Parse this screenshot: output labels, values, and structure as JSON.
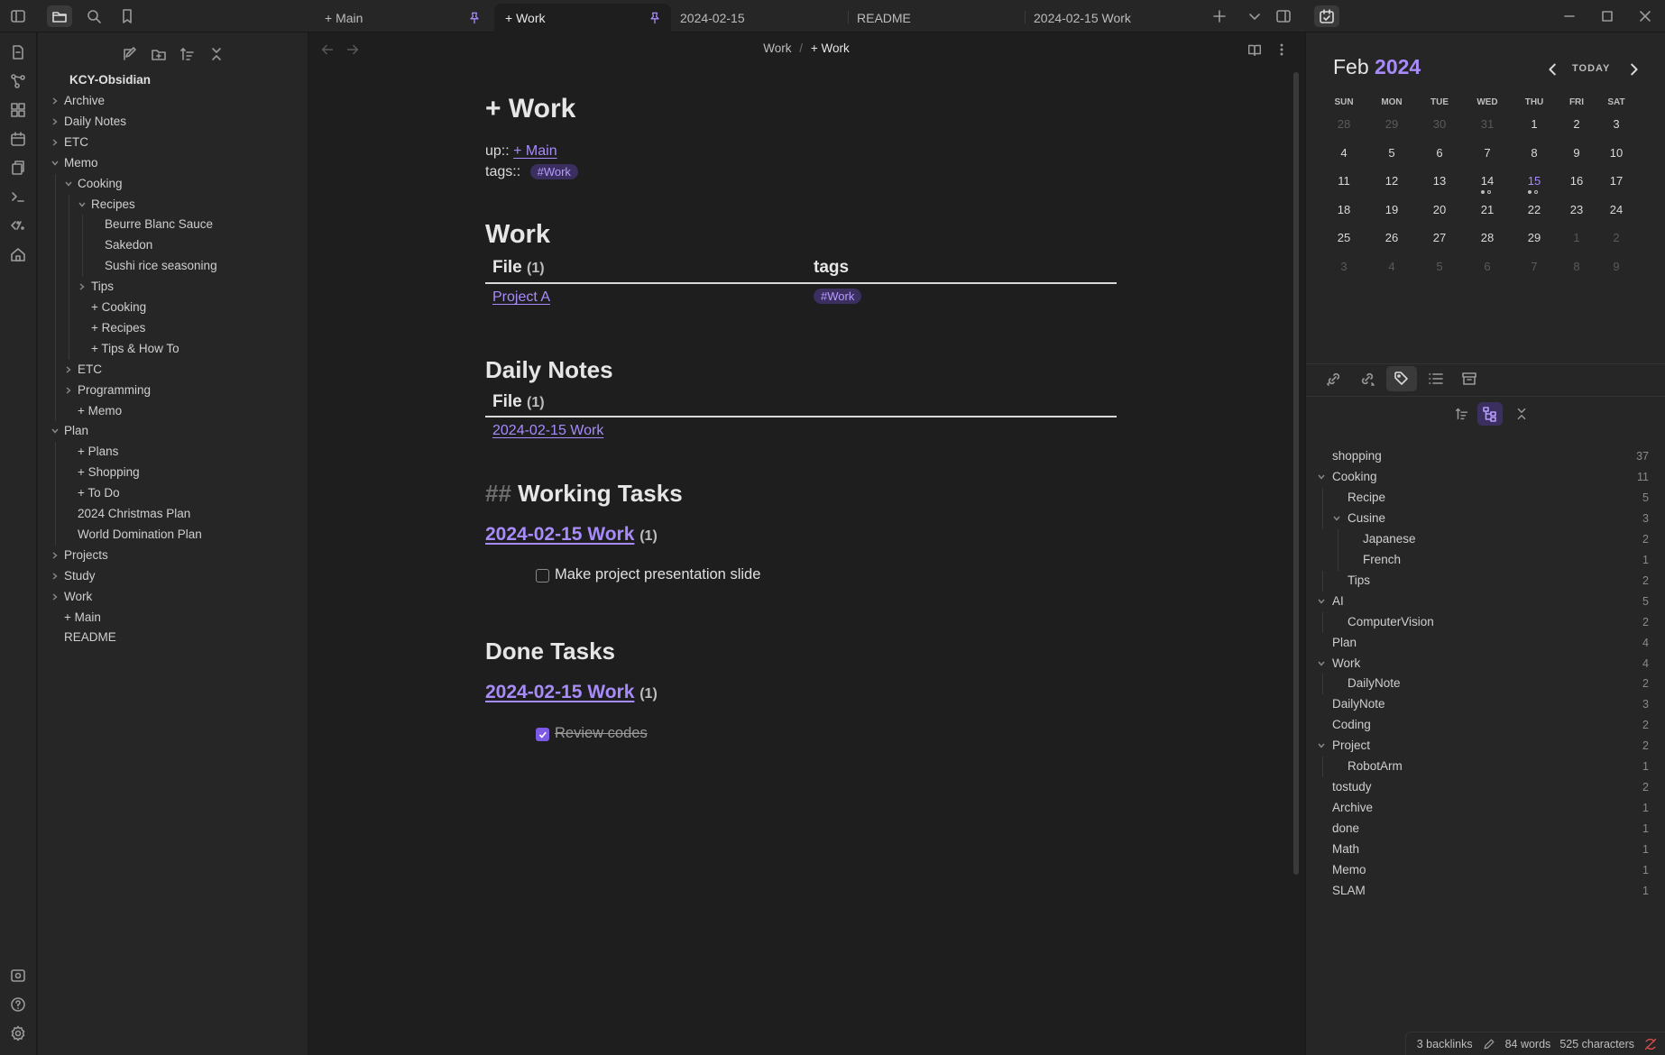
{
  "tabs": [
    {
      "label": "+ Main",
      "pinned": true
    },
    {
      "label": "+ Work",
      "pinned": true,
      "active": true
    },
    {
      "label": "2024-02-15"
    },
    {
      "label": "README"
    },
    {
      "label": "2024-02-15 Work"
    }
  ],
  "explorer": {
    "vault_name": "KCY-Obsidian",
    "items": [
      {
        "label": "Archive",
        "depth": 0,
        "folder": true,
        "open": false
      },
      {
        "label": "Daily Notes",
        "depth": 0,
        "folder": true,
        "open": false
      },
      {
        "label": "ETC",
        "depth": 0,
        "folder": true,
        "open": false
      },
      {
        "label": "Memo",
        "depth": 0,
        "folder": true,
        "open": true
      },
      {
        "label": "Cooking",
        "depth": 1,
        "folder": true,
        "open": true
      },
      {
        "label": "Recipes",
        "depth": 2,
        "folder": true,
        "open": true
      },
      {
        "label": "Beurre Blanc Sauce",
        "depth": 3,
        "folder": false
      },
      {
        "label": "Sakedon",
        "depth": 3,
        "folder": false
      },
      {
        "label": "Sushi rice seasoning",
        "depth": 3,
        "folder": false
      },
      {
        "label": "Tips",
        "depth": 2,
        "folder": true,
        "open": false
      },
      {
        "label": "+ Cooking",
        "depth": 2,
        "folder": false
      },
      {
        "label": "+ Recipes",
        "depth": 2,
        "folder": false
      },
      {
        "label": "+ Tips & How To",
        "depth": 2,
        "folder": false
      },
      {
        "label": "ETC",
        "depth": 1,
        "folder": true,
        "open": false
      },
      {
        "label": "Programming",
        "depth": 1,
        "folder": true,
        "open": false
      },
      {
        "label": "+ Memo",
        "depth": 1,
        "folder": false
      },
      {
        "label": "Plan",
        "depth": 0,
        "folder": true,
        "open": true
      },
      {
        "label": "+ Plans",
        "depth": 1,
        "folder": false
      },
      {
        "label": "+ Shopping",
        "depth": 1,
        "folder": false
      },
      {
        "label": "+ To Do",
        "depth": 1,
        "folder": false
      },
      {
        "label": "2024 Christmas Plan",
        "depth": 1,
        "folder": false
      },
      {
        "label": "World Domination Plan",
        "depth": 1,
        "folder": false
      },
      {
        "label": "Projects",
        "depth": 0,
        "folder": true,
        "open": false
      },
      {
        "label": "Study",
        "depth": 0,
        "folder": true,
        "open": false
      },
      {
        "label": "Work",
        "depth": 0,
        "folder": true,
        "open": false
      },
      {
        "label": "+ Main",
        "depth": 0,
        "folder": false
      },
      {
        "label": "README",
        "depth": 0,
        "folder": false
      }
    ]
  },
  "breadcrumb": {
    "parent": "Work",
    "separator": "/",
    "current": "+ Work"
  },
  "note": {
    "title": "+ Work",
    "up_label": "up::",
    "up_link": "+ Main",
    "tags_label": "tags::",
    "tags_value": "#Work",
    "work_heading": "Work",
    "work_table": {
      "col_file": "File",
      "col_file_count": "(1)",
      "col_tags": "tags",
      "row_file": "Project A",
      "row_tag": "#Work"
    },
    "daily_heading": "Daily Notes",
    "daily_table": {
      "col_file": "File",
      "col_file_count": "(1)",
      "row_file": "2024-02-15 Work"
    },
    "working_heading_marker": "##",
    "working_heading": "Working Tasks",
    "working_group": "2024-02-15 Work",
    "working_group_count": "(1)",
    "working_task": "Make project presentation slide",
    "done_heading": "Done Tasks",
    "done_group": "2024-02-15 Work",
    "done_group_count": "(1)",
    "done_task": "Review codes"
  },
  "calendar": {
    "month": "Feb",
    "year": "2024",
    "today_label": "TODAY",
    "weekdays": [
      "SUN",
      "MON",
      "TUE",
      "WED",
      "THU",
      "FRI",
      "SAT"
    ],
    "weeks": [
      [
        {
          "d": "28",
          "dim": true
        },
        {
          "d": "29",
          "dim": true
        },
        {
          "d": "30",
          "dim": true
        },
        {
          "d": "31",
          "dim": true
        },
        {
          "d": "1"
        },
        {
          "d": "2"
        },
        {
          "d": "3"
        }
      ],
      [
        {
          "d": "4"
        },
        {
          "d": "5"
        },
        {
          "d": "6"
        },
        {
          "d": "7"
        },
        {
          "d": "8"
        },
        {
          "d": "9"
        },
        {
          "d": "10"
        }
      ],
      [
        {
          "d": "11"
        },
        {
          "d": "12"
        },
        {
          "d": "13"
        },
        {
          "d": "14",
          "dots": [
            "filled",
            "hollow"
          ]
        },
        {
          "d": "15",
          "today": true,
          "dots": [
            "filled",
            "hollow"
          ]
        },
        {
          "d": "16"
        },
        {
          "d": "17"
        }
      ],
      [
        {
          "d": "18"
        },
        {
          "d": "19"
        },
        {
          "d": "20"
        },
        {
          "d": "21"
        },
        {
          "d": "22"
        },
        {
          "d": "23"
        },
        {
          "d": "24"
        }
      ],
      [
        {
          "d": "25"
        },
        {
          "d": "26"
        },
        {
          "d": "27"
        },
        {
          "d": "28"
        },
        {
          "d": "29"
        },
        {
          "d": "1",
          "dim": true
        },
        {
          "d": "2",
          "dim": true
        }
      ],
      [
        {
          "d": "3",
          "dim": true
        },
        {
          "d": "4",
          "dim": true
        },
        {
          "d": "5",
          "dim": true
        },
        {
          "d": "6",
          "dim": true
        },
        {
          "d": "7",
          "dim": true
        },
        {
          "d": "8",
          "dim": true
        },
        {
          "d": "9",
          "dim": true
        }
      ]
    ]
  },
  "tags_pane": {
    "items": [
      {
        "label": "shopping",
        "count": "37",
        "depth": 0,
        "chevron": false
      },
      {
        "label": "Cooking",
        "count": "11",
        "depth": 0,
        "chevron": true
      },
      {
        "label": "Recipe",
        "count": "5",
        "depth": 1,
        "chevron": false
      },
      {
        "label": "Cusine",
        "count": "3",
        "depth": 1,
        "chevron": true
      },
      {
        "label": "Japanese",
        "count": "2",
        "depth": 2,
        "chevron": false
      },
      {
        "label": "French",
        "count": "1",
        "depth": 2,
        "chevron": false
      },
      {
        "label": "Tips",
        "count": "2",
        "depth": 1,
        "chevron": false
      },
      {
        "label": "AI",
        "count": "5",
        "depth": 0,
        "chevron": true
      },
      {
        "label": "ComputerVision",
        "count": "2",
        "depth": 1,
        "chevron": false
      },
      {
        "label": "Plan",
        "count": "4",
        "depth": 0,
        "chevron": false
      },
      {
        "label": "Work",
        "count": "4",
        "depth": 0,
        "chevron": true
      },
      {
        "label": "DailyNote",
        "count": "2",
        "depth": 1,
        "chevron": false
      },
      {
        "label": "DailyNote",
        "count": "3",
        "depth": 0,
        "chevron": false
      },
      {
        "label": "Coding",
        "count": "2",
        "depth": 0,
        "chevron": false
      },
      {
        "label": "Project",
        "count": "2",
        "depth": 0,
        "chevron": true
      },
      {
        "label": "RobotArm",
        "count": "1",
        "depth": 1,
        "chevron": false
      },
      {
        "label": "tostudy",
        "count": "2",
        "depth": 0,
        "chevron": false
      },
      {
        "label": "Archive",
        "count": "1",
        "depth": 0,
        "chevron": false
      },
      {
        "label": "done",
        "count": "1",
        "depth": 0,
        "chevron": false
      },
      {
        "label": "Math",
        "count": "1",
        "depth": 0,
        "chevron": false
      },
      {
        "label": "Memo",
        "count": "1",
        "depth": 0,
        "chevron": false
      },
      {
        "label": "SLAM",
        "count": "1",
        "depth": 0,
        "chevron": false
      }
    ]
  },
  "status": {
    "backlinks": "3 backlinks",
    "words": "84 words",
    "characters": "525 characters"
  },
  "colors": {
    "accent": "#a88bfa",
    "tag_bg": "#3a2f5e",
    "checkbox": "#7c5ae6"
  }
}
